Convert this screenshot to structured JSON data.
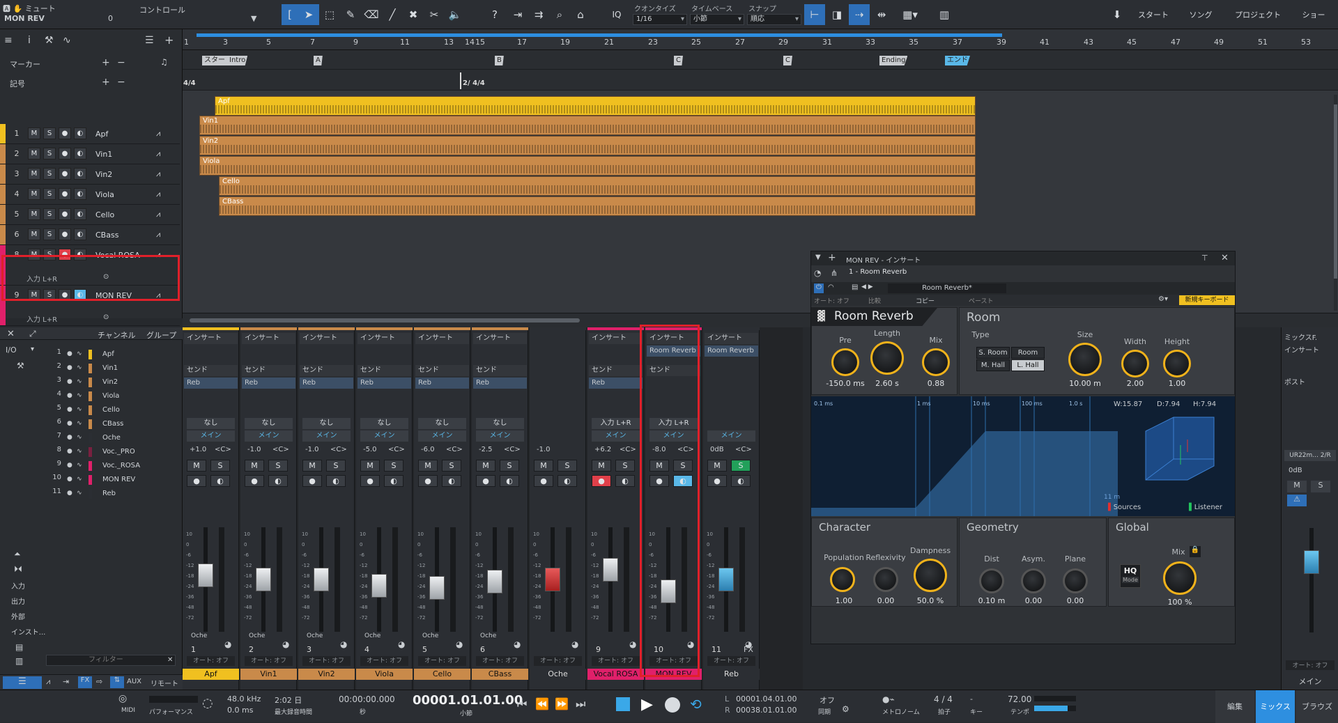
{
  "toolbar": {
    "mute_label": "ミュート",
    "control_label": "コントロール",
    "track_name": "MON REV",
    "value_zero": "0",
    "iq": "IQ",
    "quantize_label": "クオンタイズ",
    "quantize_value": "1/16",
    "timebase_label": "タイムベース",
    "timebase_value": "小節",
    "snap_label": "スナップ",
    "snap_value": "順応",
    "page_start": "スタート",
    "page_song": "ソング",
    "page_project": "プロジェクト",
    "page_show": "ショー",
    "help": "?"
  },
  "track_header": {
    "marker_label": "マーカー",
    "signature_label": "記号",
    "time_sig": "4/4",
    "time_sig2": "4/4",
    "time_sig2_bar": "2/"
  },
  "tracks": [
    {
      "num": "1",
      "name": "Apf",
      "color": "#f0c020"
    },
    {
      "num": "2",
      "name": "Vin1",
      "color": "#c98a4a"
    },
    {
      "num": "3",
      "name": "Vin2",
      "color": "#c98a4a"
    },
    {
      "num": "4",
      "name": "Viola",
      "color": "#c98a4a"
    },
    {
      "num": "5",
      "name": "Cello",
      "color": "#c98a4a"
    },
    {
      "num": "6",
      "name": "CBass",
      "color": "#c98a4a"
    },
    {
      "num": "8",
      "name": "Vocal ROSA",
      "color": "#e0206a",
      "input": "入力 L+R"
    },
    {
      "num": "9",
      "name": "MON REV",
      "color": "#e0206a",
      "input": "入力 L+R"
    }
  ],
  "mute_btn": "M",
  "solo_btn": "S",
  "ruler": [
    "1",
    "3",
    "5",
    "7",
    "9",
    "11",
    "13",
    "14",
    "15",
    "17",
    "19",
    "21",
    "23",
    "25",
    "27",
    "29",
    "31",
    "33",
    "35",
    "37",
    "39",
    "41",
    "43",
    "45",
    "47",
    "49",
    "51",
    "53"
  ],
  "markers": [
    "スタート",
    "Intro",
    "A",
    "B",
    "C",
    "C",
    "Ending",
    "エンド"
  ],
  "clips": [
    "Apf",
    "Vin1",
    "Vin2",
    "Viola",
    "Cello",
    "CBass"
  ],
  "mixer_left": {
    "io": "I/O",
    "channel_header": "チャンネル",
    "group_header": "グループ",
    "filter": "フィルター",
    "nav": [
      "入力",
      "出力",
      "外部",
      "インスト..."
    ],
    "bottom": [
      "AUX",
      "リモート",
      "FX"
    ],
    "channels": [
      {
        "n": "1",
        "t": "Apf",
        "c": "#f0c020"
      },
      {
        "n": "2",
        "t": "Vin1",
        "c": "#c98a4a"
      },
      {
        "n": "3",
        "t": "Vin2",
        "c": "#c98a4a"
      },
      {
        "n": "4",
        "t": "Viola",
        "c": "#c98a4a"
      },
      {
        "n": "5",
        "t": "Cello",
        "c": "#c98a4a"
      },
      {
        "n": "6",
        "t": "CBass",
        "c": "#c98a4a"
      },
      {
        "n": "7",
        "t": "Oche",
        "c": "#2b2e33"
      },
      {
        "n": "8",
        "t": "Voc._PRO",
        "c": "#7a2040"
      },
      {
        "n": "9",
        "t": "Voc._ROSA",
        "c": "#e0206a"
      },
      {
        "n": "10",
        "t": "MON REV",
        "c": "#e0206a"
      },
      {
        "n": "11",
        "t": "Reb",
        "c": "#2b2e33"
      }
    ]
  },
  "strips": [
    {
      "insert": "インサート",
      "send": "センド",
      "send_slot": "Reb",
      "in": "なし",
      "out": "メイン",
      "vol": "+1.0",
      "pan": "<C>",
      "num": "1",
      "label": "Apf",
      "color": "#f0c020",
      "fader": 0.55,
      "bus": "Oche"
    },
    {
      "insert": "インサート",
      "send": "センド",
      "send_slot": "Reb",
      "in": "なし",
      "out": "メイン",
      "vol": "-1.0",
      "pan": "<C>",
      "num": "2",
      "label": "Vin1",
      "color": "#c98a4a",
      "fader": 0.5,
      "bus": "Oche"
    },
    {
      "insert": "インサート",
      "send": "センド",
      "send_slot": "Reb",
      "in": "なし",
      "out": "メイン",
      "vol": "-1.0",
      "pan": "<C>",
      "num": "3",
      "label": "Vin2",
      "color": "#c98a4a",
      "fader": 0.5,
      "bus": "Oche"
    },
    {
      "insert": "インサート",
      "send": "センド",
      "send_slot": "Reb",
      "in": "なし",
      "out": "メイン",
      "vol": "-5.0",
      "pan": "<C>",
      "num": "4",
      "label": "Viola",
      "color": "#c98a4a",
      "fader": 0.42,
      "bus": "Oche"
    },
    {
      "insert": "インサート",
      "send": "センド",
      "send_slot": "Reb",
      "in": "なし",
      "out": "メイン",
      "vol": "-6.0",
      "pan": "<C>",
      "num": "5",
      "label": "Cello",
      "color": "#c98a4a",
      "fader": 0.4,
      "bus": "Oche"
    },
    {
      "insert": "インサート",
      "send": "センド",
      "send_slot": "Reb",
      "in": "なし",
      "out": "メイン",
      "vol": "-2.5",
      "pan": "<C>",
      "num": "6",
      "label": "CBass",
      "color": "#c98a4a",
      "fader": 0.47,
      "bus": "Oche"
    },
    {
      "insert": "",
      "send": "",
      "send_slot": "",
      "in": "",
      "out": "",
      "vol": "-1.0",
      "pan": "",
      "num": "",
      "label": "Oche",
      "color": "#2b2e33",
      "fader": 0.5,
      "bus": ""
    },
    {
      "insert": "インサート",
      "send": "センド",
      "send_slot": "Reb",
      "in": "入力 L+R",
      "out": "メイン",
      "vol": "+6.2",
      "pan": "<C>",
      "num": "9",
      "label": "Vocal ROSA",
      "color": "#e0206a",
      "fader": 0.62,
      "bus": ""
    },
    {
      "insert": "インサート",
      "send": "センド",
      "send_slot": "",
      "in": "入力 L+R",
      "out": "メイン",
      "vol": "-8.0",
      "pan": "<C>",
      "num": "10",
      "label": "MON REV",
      "color": "#e0206a",
      "fader": 0.35,
      "bus": "",
      "insert_slot": "Room Reverb"
    },
    {
      "insert": "インサート",
      "send": "",
      "send_slot": "",
      "in": "",
      "out": "メイン",
      "vol": "0dB",
      "pan": "<C>",
      "num": "11",
      "label": "Reb",
      "color": "#2b2e33",
      "fader": 0.5,
      "bus": "",
      "insert_slot": "Room Reverb",
      "fx": "FX"
    }
  ],
  "auto_off": "オート: オフ",
  "plugin": {
    "window_title": "MON REV - インサート",
    "preset_slot": "1 - Room Reverb",
    "preset_name": "Room Reverb*",
    "auto_off": "オート: オフ",
    "compare": "比較",
    "copy": "コピー",
    "paste": "ペースト",
    "new_keyboard": "新規キーボード",
    "title": "Room Reverb",
    "pre_label": "Pre",
    "pre_val": "-150.0 ms",
    "length_label": "Length",
    "length_val": "2.60 s",
    "mix_label": "Mix",
    "mix_val": "0.88",
    "room_title": "Room",
    "type_label": "Type",
    "types": [
      "S. Room",
      "Room",
      "M. Hall",
      "L. Hall"
    ],
    "size_label": "Size",
    "size_val": "10.00 m",
    "width_label": "Width",
    "width_val": "2.00",
    "height_label": "Height",
    "height_val": "1.00",
    "vis_ticks": [
      "0.1 ms",
      "1 ms",
      "10 ms",
      "100 ms",
      "1.0 s"
    ],
    "vis_w": "W:15.87",
    "vis_d": "D:7.94",
    "vis_h": "H:7.94",
    "vis_scale": "11 m",
    "sources": "Sources",
    "listener": "Listener",
    "character_title": "Character",
    "population_label": "Population",
    "population_val": "1.00",
    "reflexivity_label": "Reflexivity",
    "reflexivity_val": "0.00",
    "dampness_label": "Dampness",
    "dampness_val": "50.0 %",
    "geometry_title": "Geometry",
    "dist_label": "Dist",
    "dist_val": "0.10 m",
    "asym_label": "Asym.",
    "asym_val": "0.00",
    "plane_label": "Plane",
    "plane_val": "0.00",
    "global_title": "Global",
    "gmix_label": "Mix",
    "gmix_val": "100 %",
    "hq": "HQ",
    "mode": "Mode"
  },
  "right_strip": {
    "title": "ミックスF.",
    "insert": "インサート",
    "post": "ポスト",
    "device": "UR22m... 2/R",
    "vol": "0dB",
    "label": "メイン"
  },
  "transport": {
    "midi": "MIDI",
    "perf": "パフォーマンス",
    "rate": "48.0 kHz",
    "latency": "0.0 ms",
    "rec_time": "2:02 日",
    "rec_label": "最大録音時間",
    "time": "00:00:00.000",
    "time_unit": "秒",
    "bars": "00001.01.01.00",
    "bars_unit": "小節",
    "loop_l": "00001.04.01.00",
    "loop_r": "00038.01.01.00",
    "L": "L",
    "R": "R",
    "sync": "オフ",
    "sync_label": "同期",
    "metro_label": "メトロノーム",
    "sig": "4 / 4",
    "sig_label": "拍子",
    "key_label": "キー",
    "tempo": "72.00",
    "tempo_label": "テンポ",
    "edit": "編集",
    "mix": "ミックス",
    "browse": "ブラウズ"
  }
}
